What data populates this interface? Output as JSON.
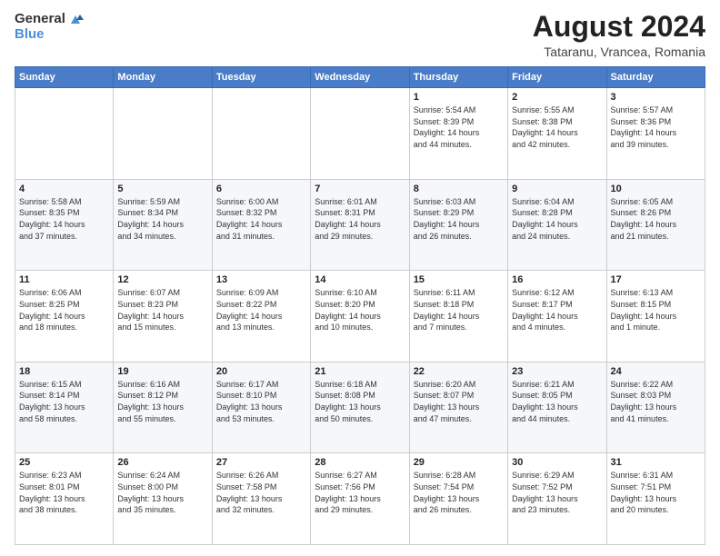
{
  "logo": {
    "text_general": "General",
    "text_blue": "Blue"
  },
  "title": {
    "month": "August 2024",
    "location": "Tataranu, Vrancea, Romania"
  },
  "headers": [
    "Sunday",
    "Monday",
    "Tuesday",
    "Wednesday",
    "Thursday",
    "Friday",
    "Saturday"
  ],
  "weeks": [
    [
      {
        "day": "",
        "info": ""
      },
      {
        "day": "",
        "info": ""
      },
      {
        "day": "",
        "info": ""
      },
      {
        "day": "",
        "info": ""
      },
      {
        "day": "1",
        "info": "Sunrise: 5:54 AM\nSunset: 8:39 PM\nDaylight: 14 hours\nand 44 minutes."
      },
      {
        "day": "2",
        "info": "Sunrise: 5:55 AM\nSunset: 8:38 PM\nDaylight: 14 hours\nand 42 minutes."
      },
      {
        "day": "3",
        "info": "Sunrise: 5:57 AM\nSunset: 8:36 PM\nDaylight: 14 hours\nand 39 minutes."
      }
    ],
    [
      {
        "day": "4",
        "info": "Sunrise: 5:58 AM\nSunset: 8:35 PM\nDaylight: 14 hours\nand 37 minutes."
      },
      {
        "day": "5",
        "info": "Sunrise: 5:59 AM\nSunset: 8:34 PM\nDaylight: 14 hours\nand 34 minutes."
      },
      {
        "day": "6",
        "info": "Sunrise: 6:00 AM\nSunset: 8:32 PM\nDaylight: 14 hours\nand 31 minutes."
      },
      {
        "day": "7",
        "info": "Sunrise: 6:01 AM\nSunset: 8:31 PM\nDaylight: 14 hours\nand 29 minutes."
      },
      {
        "day": "8",
        "info": "Sunrise: 6:03 AM\nSunset: 8:29 PM\nDaylight: 14 hours\nand 26 minutes."
      },
      {
        "day": "9",
        "info": "Sunrise: 6:04 AM\nSunset: 8:28 PM\nDaylight: 14 hours\nand 24 minutes."
      },
      {
        "day": "10",
        "info": "Sunrise: 6:05 AM\nSunset: 8:26 PM\nDaylight: 14 hours\nand 21 minutes."
      }
    ],
    [
      {
        "day": "11",
        "info": "Sunrise: 6:06 AM\nSunset: 8:25 PM\nDaylight: 14 hours\nand 18 minutes."
      },
      {
        "day": "12",
        "info": "Sunrise: 6:07 AM\nSunset: 8:23 PM\nDaylight: 14 hours\nand 15 minutes."
      },
      {
        "day": "13",
        "info": "Sunrise: 6:09 AM\nSunset: 8:22 PM\nDaylight: 14 hours\nand 13 minutes."
      },
      {
        "day": "14",
        "info": "Sunrise: 6:10 AM\nSunset: 8:20 PM\nDaylight: 14 hours\nand 10 minutes."
      },
      {
        "day": "15",
        "info": "Sunrise: 6:11 AM\nSunset: 8:18 PM\nDaylight: 14 hours\nand 7 minutes."
      },
      {
        "day": "16",
        "info": "Sunrise: 6:12 AM\nSunset: 8:17 PM\nDaylight: 14 hours\nand 4 minutes."
      },
      {
        "day": "17",
        "info": "Sunrise: 6:13 AM\nSunset: 8:15 PM\nDaylight: 14 hours\nand 1 minute."
      }
    ],
    [
      {
        "day": "18",
        "info": "Sunrise: 6:15 AM\nSunset: 8:14 PM\nDaylight: 13 hours\nand 58 minutes."
      },
      {
        "day": "19",
        "info": "Sunrise: 6:16 AM\nSunset: 8:12 PM\nDaylight: 13 hours\nand 55 minutes."
      },
      {
        "day": "20",
        "info": "Sunrise: 6:17 AM\nSunset: 8:10 PM\nDaylight: 13 hours\nand 53 minutes."
      },
      {
        "day": "21",
        "info": "Sunrise: 6:18 AM\nSunset: 8:08 PM\nDaylight: 13 hours\nand 50 minutes."
      },
      {
        "day": "22",
        "info": "Sunrise: 6:20 AM\nSunset: 8:07 PM\nDaylight: 13 hours\nand 47 minutes."
      },
      {
        "day": "23",
        "info": "Sunrise: 6:21 AM\nSunset: 8:05 PM\nDaylight: 13 hours\nand 44 minutes."
      },
      {
        "day": "24",
        "info": "Sunrise: 6:22 AM\nSunset: 8:03 PM\nDaylight: 13 hours\nand 41 minutes."
      }
    ],
    [
      {
        "day": "25",
        "info": "Sunrise: 6:23 AM\nSunset: 8:01 PM\nDaylight: 13 hours\nand 38 minutes."
      },
      {
        "day": "26",
        "info": "Sunrise: 6:24 AM\nSunset: 8:00 PM\nDaylight: 13 hours\nand 35 minutes."
      },
      {
        "day": "27",
        "info": "Sunrise: 6:26 AM\nSunset: 7:58 PM\nDaylight: 13 hours\nand 32 minutes."
      },
      {
        "day": "28",
        "info": "Sunrise: 6:27 AM\nSunset: 7:56 PM\nDaylight: 13 hours\nand 29 minutes."
      },
      {
        "day": "29",
        "info": "Sunrise: 6:28 AM\nSunset: 7:54 PM\nDaylight: 13 hours\nand 26 minutes."
      },
      {
        "day": "30",
        "info": "Sunrise: 6:29 AM\nSunset: 7:52 PM\nDaylight: 13 hours\nand 23 minutes."
      },
      {
        "day": "31",
        "info": "Sunrise: 6:31 AM\nSunset: 7:51 PM\nDaylight: 13 hours\nand 20 minutes."
      }
    ]
  ]
}
